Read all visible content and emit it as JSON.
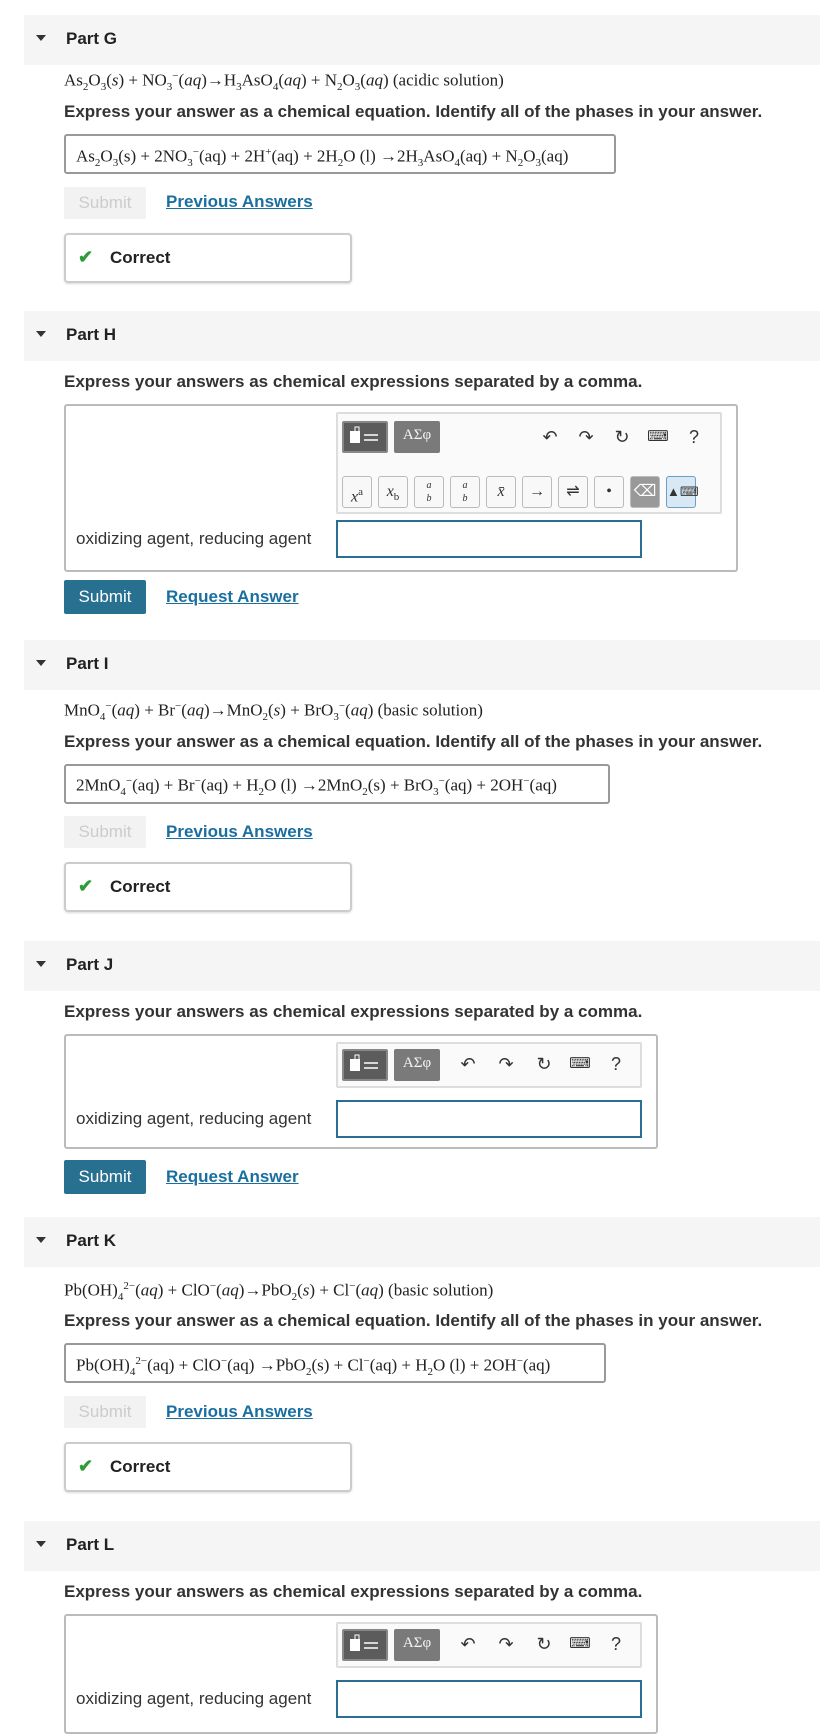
{
  "parts": {
    "g": {
      "title": "Part G",
      "equation_html": "As<sub>2</sub>O<sub>3</sub>(<i>s</i>) + NO<sub>3</sub><sup>−</sup>(<i>aq</i>)→H<sub>3</sub>AsO<sub>4</sub>(<i>aq</i>) + N<sub>2</sub>O<sub>3</sub>(<i>aq</i>) (acidic solution)",
      "instruction": "Express your answer as a chemical equation. Identify all of the phases in your answer.",
      "answer_html": "As<sub>2</sub>O<sub>3</sub>(s) + 2NO<sub>3</sub><sup>−</sup>(aq) + 2H<sup>+</sup>(aq) + 2H<sub>2</sub>O (l) →2H<sub>3</sub>AsO<sub>4</sub>(aq) + N<sub>2</sub>O<sub>3</sub>(aq)",
      "submit": "Submit",
      "link": "Previous Answers",
      "status": "Correct"
    },
    "h": {
      "title": "Part H",
      "instruction": "Express your answers as chemical expressions separated by a comma.",
      "label": "oxidizing agent, reducing agent",
      "input_value": "",
      "submit": "Submit",
      "link": "Request Answer"
    },
    "i": {
      "title": "Part I",
      "equation_html": "MnO<sub>4</sub><sup>−</sup>(<i>aq</i>) + Br<sup>−</sup>(<i>aq</i>)→MnO<sub>2</sub>(<i>s</i>) + BrO<sub>3</sub><sup>−</sup>(<i>aq</i>) (basic solution)",
      "instruction": "Express your answer as a chemical equation. Identify all of the phases in your answer.",
      "answer_html": "2MnO<sub>4</sub><sup>−</sup>(aq) + Br<sup>−</sup>(aq) + H<sub>2</sub>O (l) →2MnO<sub>2</sub>(s) + BrO<sub>3</sub><sup>−</sup>(aq) + 2OH<sup>−</sup>(aq)",
      "submit": "Submit",
      "link": "Previous Answers",
      "status": "Correct"
    },
    "j": {
      "title": "Part J",
      "instruction": "Express your answers as chemical expressions separated by a comma.",
      "label": "oxidizing agent, reducing agent",
      "input_value": "",
      "submit": "Submit",
      "link": "Request Answer"
    },
    "k": {
      "title": "Part K",
      "equation_html": "Pb(OH)<sub>4</sub><sup>2−</sup>(<i>aq</i>) + ClO<sup>−</sup>(<i>aq</i>)→PbO<sub>2</sub>(<i>s</i>) + Cl<sup>−</sup>(<i>aq</i>) (basic solution)",
      "instruction": "Express your answer as a chemical equation. Identify all of the phases in your answer.",
      "answer_html": "Pb(OH)<sub>4</sub><sup>2−</sup>(aq) + ClO<sup>−</sup>(aq) →PbO<sub>2</sub>(s) + Cl<sup>−</sup>(aq) + H<sub>2</sub>O (l) + 2OH<sup>−</sup>(aq)",
      "submit": "Submit",
      "link": "Previous Answers",
      "status": "Correct"
    },
    "l": {
      "title": "Part L",
      "instruction": "Express your answers as chemical expressions separated by a comma.",
      "label": "oxidizing agent, reducing agent",
      "input_value": ""
    }
  },
  "toolbar": {
    "greek": "ΑΣφ",
    "help": "?",
    "undo_icon": "undo-icon",
    "redo_icon": "redo-icon",
    "reset_icon": "reset-icon",
    "keyboard_icon": "keyboard-icon",
    "row2": [
      "x^a",
      "x_b",
      "a/b",
      "a/b",
      "x̄",
      "→",
      "⇌",
      "•"
    ]
  },
  "colors": {
    "submit_bg": "#28708f",
    "link": "#1a6fa0",
    "check": "#2e9b3b"
  }
}
